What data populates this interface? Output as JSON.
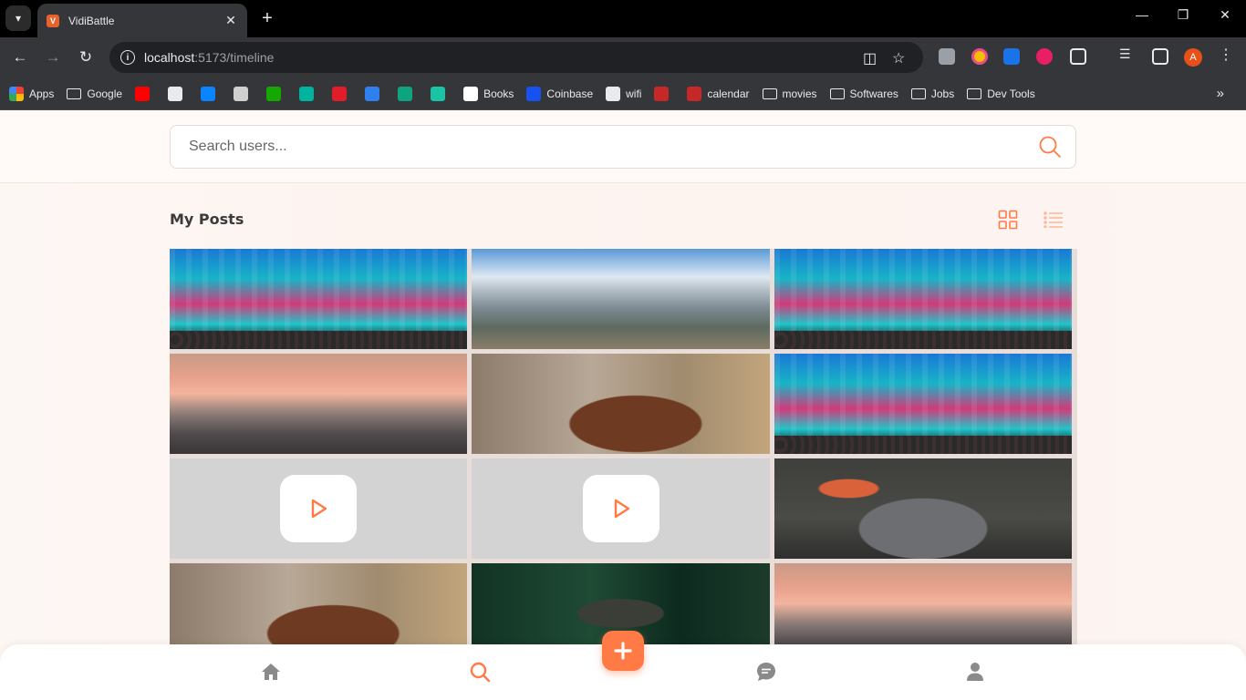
{
  "browser": {
    "tab_title": "VidiBattle",
    "tab_favicon_text": "V",
    "url_host": "localhost",
    "url_path": ":5173/timeline",
    "avatar_letter": "A",
    "bookmarks": [
      {
        "label": "Apps",
        "type": "apps"
      },
      {
        "label": "Google",
        "type": "folder"
      },
      {
        "label": "",
        "type": "icon",
        "color": "#ff0000"
      },
      {
        "label": "",
        "type": "icon",
        "color": "#e8eaed"
      },
      {
        "label": "",
        "type": "icon",
        "color": "#0a84ff"
      },
      {
        "label": "",
        "type": "icon",
        "color": "#cfcfcf"
      },
      {
        "label": "",
        "type": "icon",
        "color": "#14a800"
      },
      {
        "label": "",
        "type": "icon",
        "color": "#00b39f"
      },
      {
        "label": "",
        "type": "icon",
        "color": "#e11d2a"
      },
      {
        "label": "",
        "type": "icon",
        "color": "#2f80ed"
      },
      {
        "label": "",
        "type": "icon",
        "color": "#10a37f"
      },
      {
        "label": "",
        "type": "icon",
        "color": "#19c3a4"
      },
      {
        "label": "Books",
        "type": "icon",
        "color": "#ffffff"
      },
      {
        "label": "Coinbase",
        "type": "icon",
        "color": "#1652f0"
      },
      {
        "label": "wifi",
        "type": "icon",
        "color": "#e8eaed"
      },
      {
        "label": "",
        "type": "icon",
        "color": "#c62828"
      },
      {
        "label": "calendar",
        "type": "icon",
        "color": "#c62828"
      },
      {
        "label": "movies",
        "type": "folder"
      },
      {
        "label": "Softwares",
        "type": "folder"
      },
      {
        "label": "Jobs",
        "type": "folder"
      },
      {
        "label": "Dev Tools",
        "type": "folder"
      }
    ]
  },
  "page": {
    "search_placeholder": "Search users...",
    "section_title": "My Posts",
    "accent_color": "#ff7a45",
    "posts": [
      {
        "kind": "city"
      },
      {
        "kind": "mountain"
      },
      {
        "kind": "city"
      },
      {
        "kind": "sunset"
      },
      {
        "kind": "horse"
      },
      {
        "kind": "city"
      },
      {
        "kind": "video"
      },
      {
        "kind": "video"
      },
      {
        "kind": "woman"
      },
      {
        "kind": "horse"
      },
      {
        "kind": "forest"
      },
      {
        "kind": "sunset"
      }
    ]
  },
  "bottom_nav": {
    "items": [
      "home-icon",
      "search-icon",
      "chat-icon",
      "user-icon"
    ],
    "active": "search-icon",
    "fab_icon": "plus-icon"
  }
}
